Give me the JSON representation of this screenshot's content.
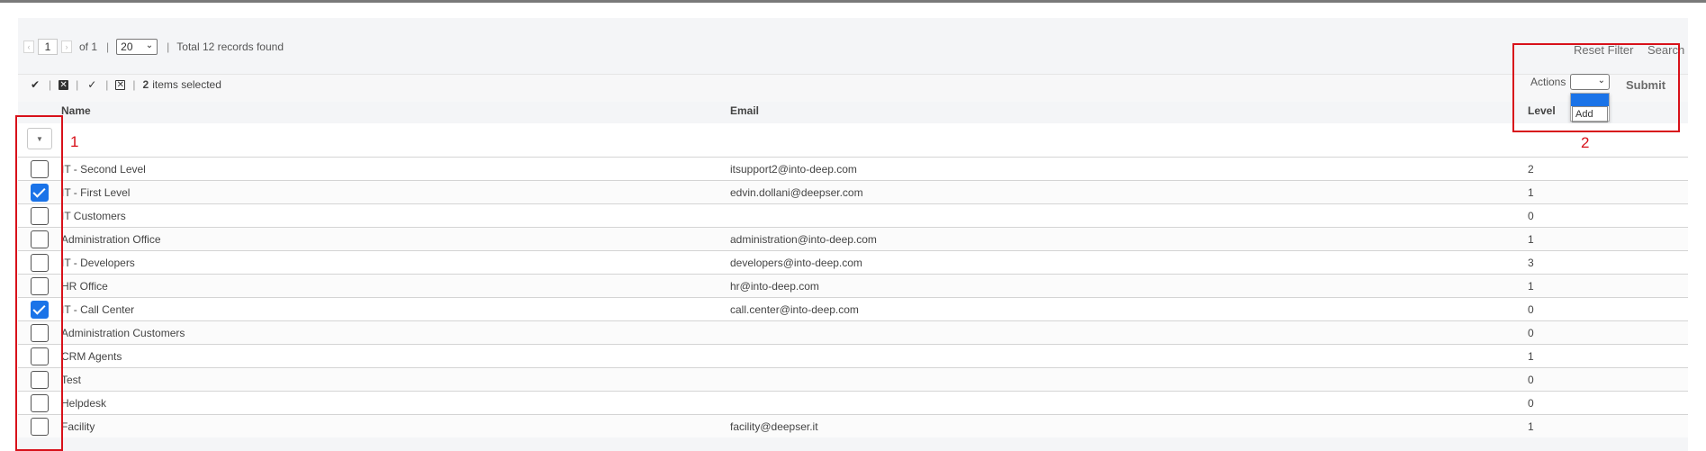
{
  "pager": {
    "prev": "‹",
    "page": "1",
    "next": "›",
    "of_text": "of 1",
    "sep": "|",
    "per_page": "20",
    "total_text": "Total 12 records found"
  },
  "links": {
    "reset_filter": "Reset Filter",
    "search": "Search"
  },
  "massaction": {
    "sep": "|",
    "selected_count": "2",
    "selected_suffix": "items selected",
    "actions_label": "Actions",
    "actions_selected": "",
    "actions_options": [
      "",
      "Add"
    ],
    "submit": "Submit"
  },
  "columns": {
    "name": "Name",
    "email": "Email",
    "level": "Level"
  },
  "rows": [
    {
      "name": "IT - Second Level",
      "email": "itsupport2@into-deep.com",
      "level": "2",
      "checked": false
    },
    {
      "name": "IT - First Level",
      "email": "edvin.dollani@deepser.com",
      "level": "1",
      "checked": true
    },
    {
      "name": "IT Customers",
      "email": "",
      "level": "0",
      "checked": false
    },
    {
      "name": "Administration Office",
      "email": "administration@into-deep.com",
      "level": "1",
      "checked": false
    },
    {
      "name": "IT - Developers",
      "email": "developers@into-deep.com",
      "level": "3",
      "checked": false
    },
    {
      "name": "HR Office",
      "email": "hr@into-deep.com",
      "level": "1",
      "checked": false
    },
    {
      "name": "IT - Call Center",
      "email": "call.center@into-deep.com",
      "level": "0",
      "checked": true
    },
    {
      "name": "Administration Customers",
      "email": "",
      "level": "0",
      "checked": false
    },
    {
      "name": "CRM Agents",
      "email": "",
      "level": "1",
      "checked": false
    },
    {
      "name": "Test",
      "email": "",
      "level": "0",
      "checked": false
    },
    {
      "name": "Helpdesk",
      "email": "",
      "level": "0",
      "checked": false
    },
    {
      "name": "Facility",
      "email": "facility@deepser.it",
      "level": "1",
      "checked": false
    }
  ],
  "annotations": {
    "label1": "1",
    "label2": "2",
    "color": "#d8111a"
  },
  "colors": {
    "accent": "#1a73e8",
    "panel": "#f4f5f7"
  },
  "icons": [
    "select-all-icon",
    "unselect-all-icon",
    "select-visible-icon",
    "unselect-visible-icon",
    "chevron-down-icon"
  ]
}
